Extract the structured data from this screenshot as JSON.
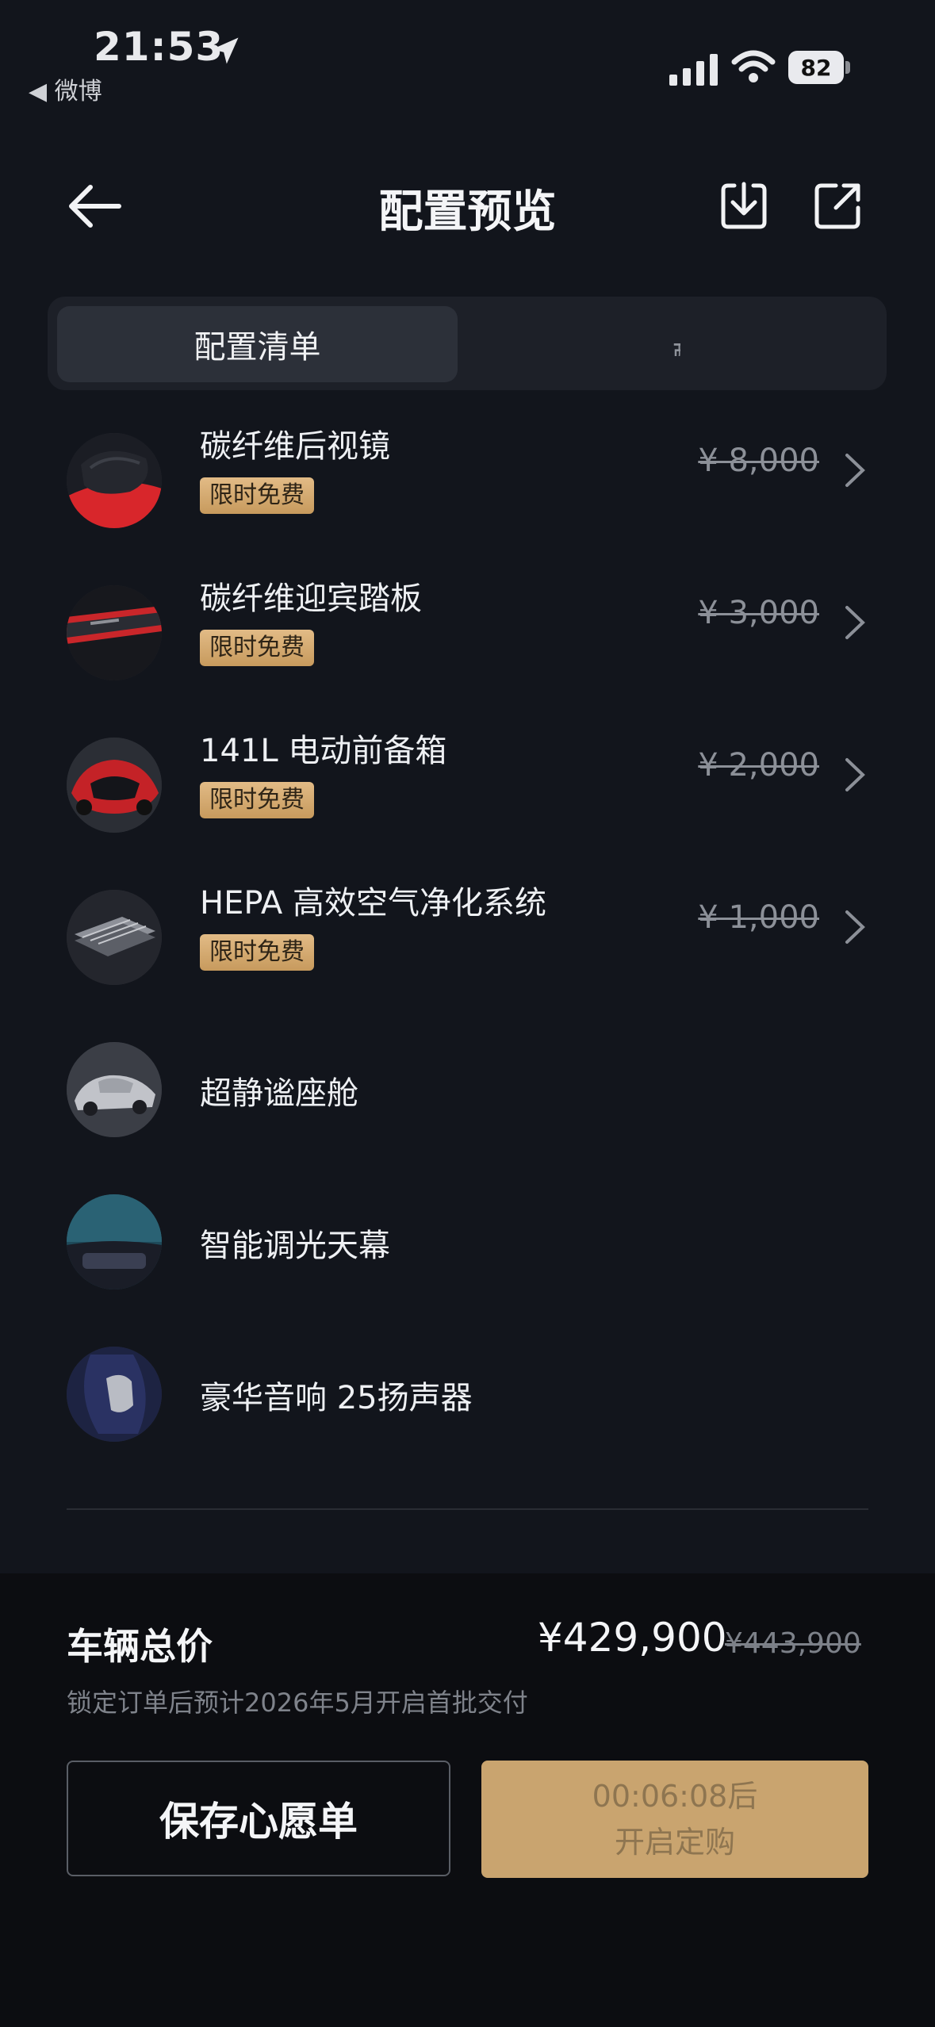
{
  "status_bar": {
    "time": "21:53",
    "back_app": "◀ 微博",
    "battery": "82"
  },
  "header": {
    "title": "配置预览"
  },
  "tabs": [
    {
      "label": "配置清单"
    },
    {
      "label": "配置图"
    }
  ],
  "items": [
    {
      "name": "碳纤维后视镜",
      "badge": "限时免费",
      "price": "¥ 8,000"
    },
    {
      "name": "碳纤维迎宾踏板",
      "badge": "限时免费",
      "price": "¥ 3,000"
    },
    {
      "name": "141L 电动前备箱",
      "badge": "限时免费",
      "price": "¥ 2,000"
    },
    {
      "name": "HEPA 高效空气净化系统",
      "badge": "限时免费",
      "price": "¥ 1,000"
    },
    {
      "name": "超静谧座舱"
    },
    {
      "name": "智能调光天幕"
    },
    {
      "name": "豪华音响 25扬声器"
    }
  ],
  "summary": {
    "total_label": "车辆总价",
    "total_price": "¥429,900",
    "original_price": "¥443,900",
    "delivery_note": "锁定订单后预计2026年5月开启首批交付"
  },
  "actions": {
    "save_label": "保存心愿单",
    "countdown": "00:06:08后",
    "order_label": "开启定购"
  },
  "colors": {
    "background": "#12151c",
    "badge_gold": "#d7ae74",
    "order_button": "#c9a46f"
  }
}
